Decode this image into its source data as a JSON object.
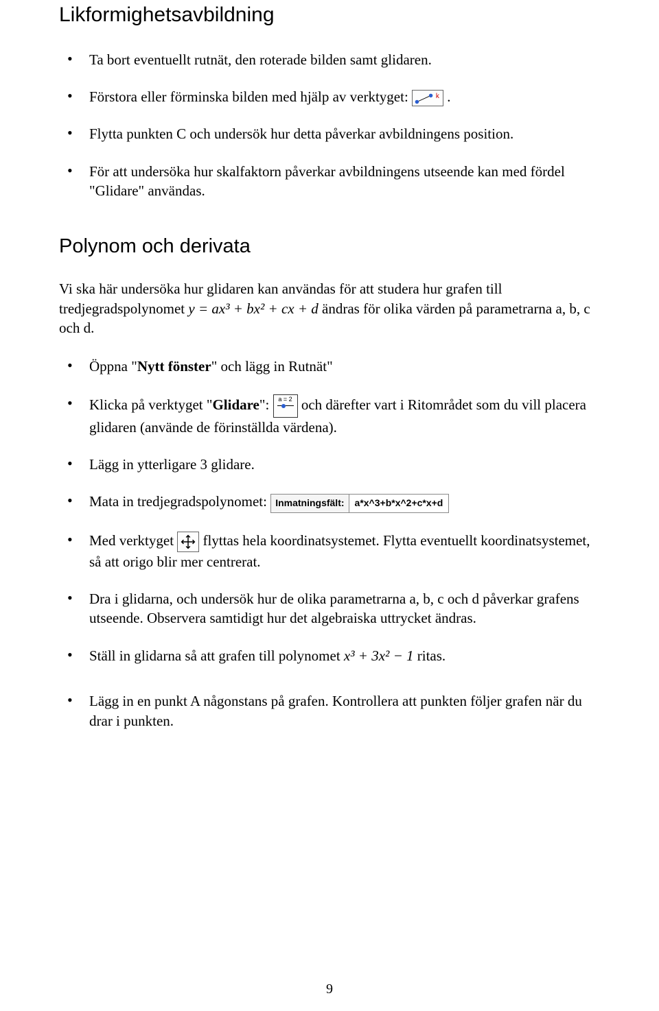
{
  "section1": {
    "title": "Likformighetsavbildning",
    "bullets": [
      {
        "text": "Ta bort eventuellt rutnät, den roterade bilden samt glidaren."
      },
      {
        "text_pre": "Förstora eller förminska bilden med hjälp av verktyget: ",
        "text_post": "."
      },
      {
        "text": "Flytta punkten C och undersök hur detta påverkar avbildningens position."
      },
      {
        "text": "För att undersöka hur skalfaktorn påverkar avbildningens utseende kan med fördel \"Glidare\" användas."
      }
    ]
  },
  "section2": {
    "title": "Polynom och derivata",
    "intro_pre": "Vi ska här undersöka hur glidaren kan användas för att studera hur grafen till tredjegradspolynomet ",
    "intro_math": "y = ax³ + bx² + cx + d",
    "intro_post": " ändras för olika värden på parametrarna a, b, c och d.",
    "bullets": [
      {
        "pre": "Öppna \"",
        "bold": "Nytt fönster",
        "post": "\" och lägg in Rutnät\""
      },
      {
        "pre": "Klicka på verktyget \"",
        "bold": "Glidare",
        "mid": "\": ",
        "post": " och därefter vart i Ritområdet som du vill placera glidaren (använde de förinställda värdena)."
      },
      {
        "text": "Lägg in ytterligare 3 glidare."
      },
      {
        "text": "Mata in tredjegradspolynomet:  "
      },
      {
        "pre": "Med verktyget ",
        "post": " flyttas hela koordinatsystemet. Flytta eventuellt koordinatsystemet, så att origo blir mer centrerat."
      },
      {
        "text": "Dra i glidarna, och undersök hur de olika parametrarna a, b, c och d påverkar grafens utseende. Observera samtidigt hur det algebraiska uttrycket ändras."
      },
      {
        "pre": "Ställ in glidarna så att grafen till polynomet ",
        "math": "x³ + 3x² − 1",
        "post": " ritas."
      },
      {
        "text": "Lägg in en punkt A någonstans på grafen. Kontrollera att punkten följer grafen när du drar i punkten."
      }
    ]
  },
  "inputField": {
    "caption": "Inmatningsfält:",
    "value": "a*x^3+b*x^2+c*x+d"
  },
  "icons": {
    "dilate_letter": "k",
    "slider_label": "a = 2"
  },
  "page_number": "9"
}
